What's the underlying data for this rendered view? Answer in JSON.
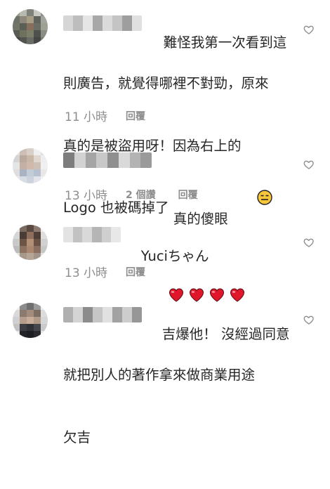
{
  "comments": [
    {
      "text_lines": [
        "難怪我第一次看到這",
        "則廣告，就覺得哪裡不對勁，原來",
        "真的是被盜用呀！因為右上的",
        "Logo 也被碼掉了"
      ],
      "time": "11 小時",
      "reply": "回覆"
    },
    {
      "text": "真的傻眼",
      "emoji": "expressionless-face-emoji",
      "time": "13 小時",
      "likes": "2 個讚",
      "reply": "回覆"
    },
    {
      "text": "Yuciちゃん",
      "emoji": "red-heart-emoji",
      "time": "13 小時",
      "reply": "回覆"
    },
    {
      "text_lines": [
        "吉爆他！ 沒經過同意",
        "就把別人的著作拿來做商業用途",
        "欠吉"
      ]
    }
  ],
  "colors": {
    "text": "#262626",
    "secondary": "#8e8e8e",
    "heart_outline": "#8e8e8e",
    "emoji_heart": "#e0162b"
  }
}
